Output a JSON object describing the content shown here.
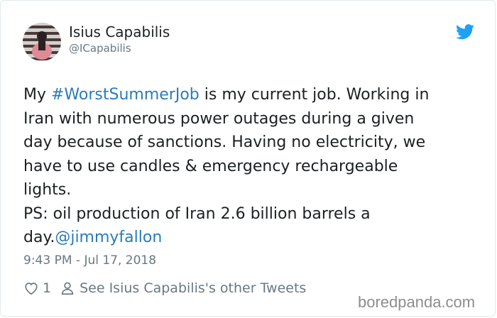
{
  "author": {
    "name": "Isius Capabilis",
    "handle": "@ICapabilis"
  },
  "tweet": {
    "lines": [
      [
        "My ",
        "#WorstSummerJob",
        " is my current job. Working in"
      ],
      "Iran with numerous power outages during a given",
      "day because of sanctions. Having no electricity, we",
      "have to use candles & emergency rechargeable",
      "lights.",
      "PS: oil production of Iran 2.6 billion barrels a",
      [
        "day.",
        "@jimmyfallon"
      ]
    ],
    "timestamp": "9:43 PM - Jul 17, 2018"
  },
  "actions": {
    "like_count": "1",
    "other_tweets_label": "See Isius Capabilis's other Tweets"
  },
  "watermark": "boredpanda.com",
  "colors": {
    "link": "#2b7bb9",
    "twitter_blue": "#1da1f2",
    "text": "#1c2022",
    "secondary": "#697882"
  },
  "icons": [
    "twitter-bird-icon",
    "heart-icon",
    "person-icon"
  ]
}
